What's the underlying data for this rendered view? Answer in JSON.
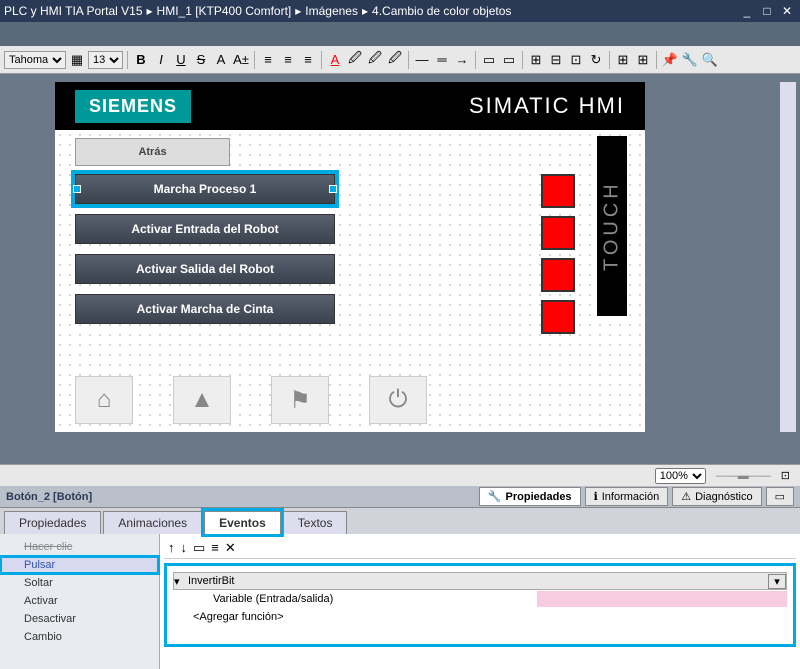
{
  "title": {
    "app": "PLC y HMI TIA Portal V15",
    "hmi": "HMI_1 [KTP400 Comfort]",
    "folder": "Imágenes",
    "screen": "4.Cambio de color objetos"
  },
  "toolbar": {
    "font": "Tahoma",
    "size": "13"
  },
  "hmi": {
    "brand": "SIEMENS",
    "product": "SIMATIC HMI",
    "touch": "TOUCH",
    "atras": "Atrás",
    "b1": "Marcha Proceso 1",
    "b2": "Activar Entrada del Robot",
    "b3": "Activar Salida del Robot",
    "b4": "Activar Marcha de Cinta"
  },
  "zoom": "100%",
  "props": {
    "object": "Botón_2 [Botón]",
    "tab_prop": "Propiedades",
    "tab_info": "Información",
    "tab_diag": "Diagnóstico",
    "sub_prop": "Propiedades",
    "sub_anim": "Animaciones",
    "sub_ev": "Eventos",
    "sub_txt": "Textos"
  },
  "events": {
    "hacerclic": "Hacer clic",
    "pulsar": "Pulsar",
    "soltar": "Soltar",
    "activar": "Activar",
    "desactivar": "Desactivar",
    "cambio": "Cambio",
    "fn": "InvertirBit",
    "var": "Variable (Entrada/salida)",
    "add": "<Agregar función>"
  }
}
